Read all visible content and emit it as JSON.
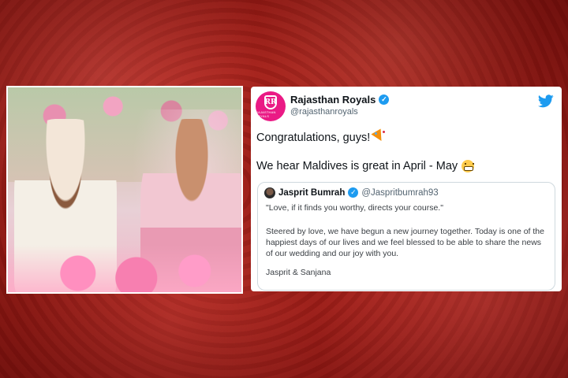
{
  "tweet": {
    "account_name": "Rajasthan Royals",
    "account_handle": "@rajasthanroyals",
    "avatar_initials": "RR",
    "avatar_caption": "RAJASTHAN ROYALS",
    "line1": "Congratulations, guys!",
    "line2": "We hear Maldives is great in April - May",
    "icons": [
      "verified-icon",
      "twitter-bird-icon",
      "party-popper-emoji",
      "grimace-emoji"
    ],
    "colors": {
      "avatar": "#ea1a85",
      "verified": "#1d9bf0",
      "bird": "#1d9bf0"
    }
  },
  "quoted_tweet": {
    "name": "Jasprit Bumrah",
    "handle": "@Jaspritbumrah93",
    "quote": "\"Love, if it finds you worthy, directs your course.\"",
    "body": "Steered by love, we have begun a new journey together. Today is one of the happiest days of our lives and we feel blessed to be able to share the news of our wedding and our joy with you.",
    "signature": "Jasprit & Sanjana"
  },
  "background_color": "#a3211c"
}
